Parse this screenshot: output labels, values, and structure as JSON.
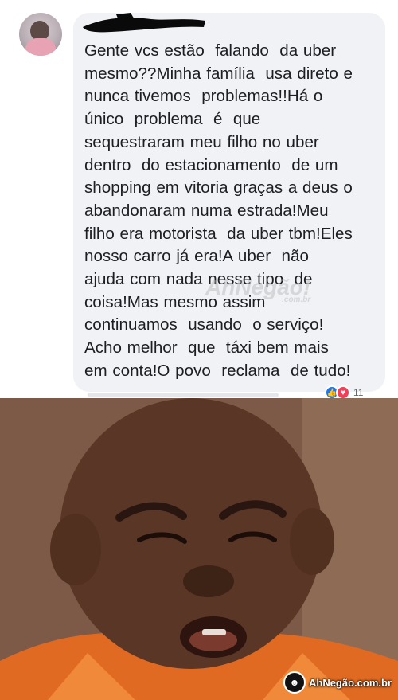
{
  "comment": {
    "text": "Gente vcs estão  falando  da uber\nmesmo??Minha família  usa direto e\nnunca tivemos  problemas!!Há o\núnico  problema  é  que\nsequestraram meu filho no uber\ndentro  do estacionamento  de um\nshopping em vitoria graças a deus o\nabandonaram numa estrada!Meu\nfilho era motorista  da uber tbm!Eles\nnosso carro já era!A uber  não\najuda com nada nesse tipo  de\ncoisa!Mas mesmo assim\ncontinuamos  usando  o serviço!\nAcho melhor  que  táxi bem mais\nem conta!O povo  reclama  de tudo!",
    "reaction_count": "11"
  },
  "watermark": {
    "text": "AhNegão!",
    "domain": ".com.br"
  },
  "branding": {
    "text": "AhNegão.com.br"
  },
  "colors": {
    "bubble": "#f0f2f5",
    "like": "#1877f2",
    "love": "#f33e58",
    "text": "#1c1e21"
  },
  "icons": {
    "like": "like-icon",
    "love": "love-icon",
    "brand": "ahnegao-logo-icon"
  }
}
